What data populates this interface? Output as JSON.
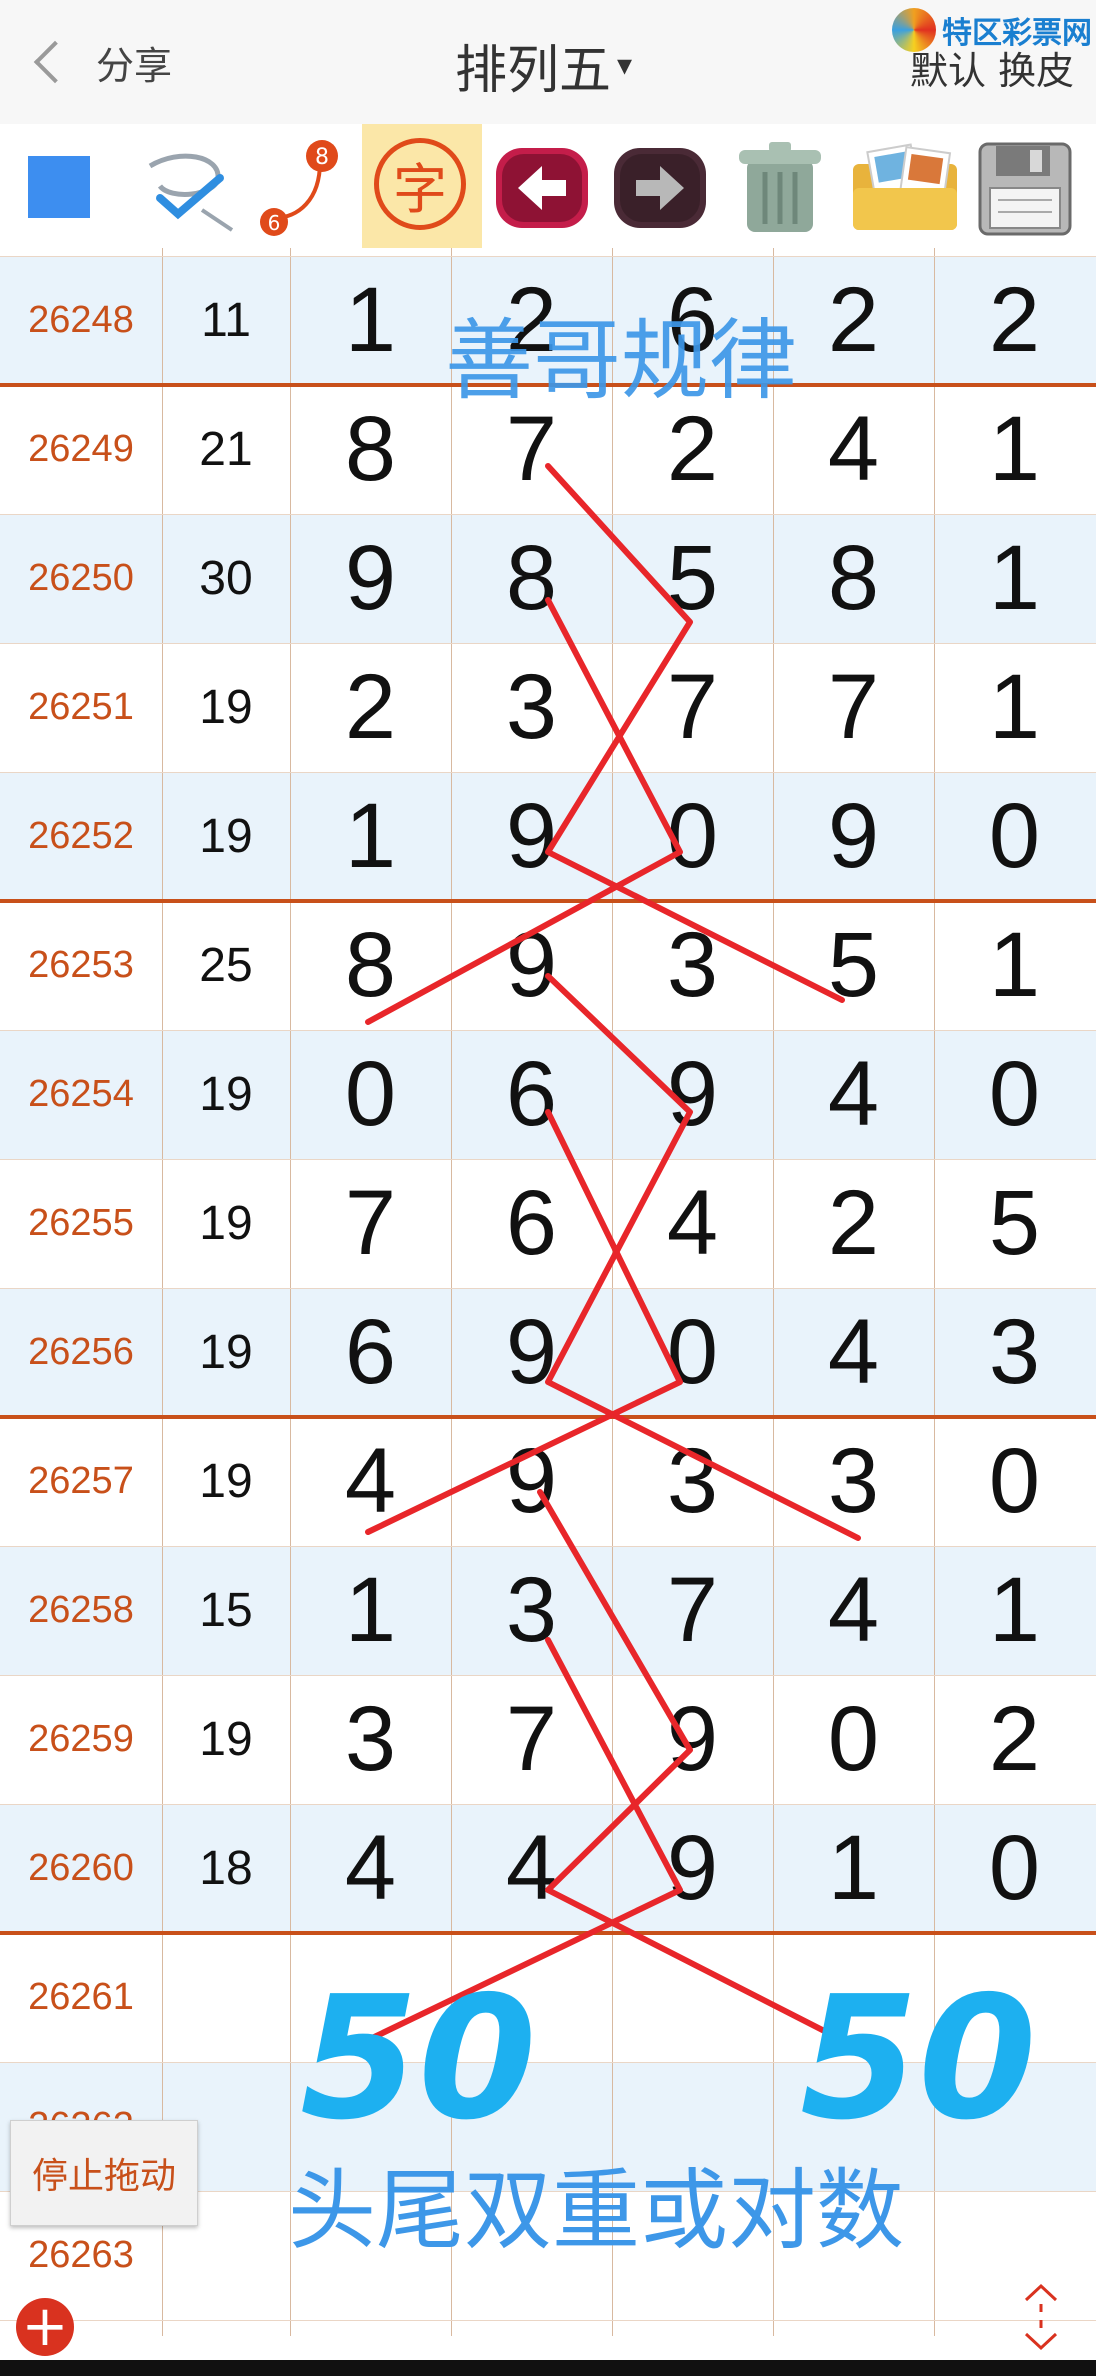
{
  "header": {
    "back_label": "分享",
    "title": "排列五",
    "title_caret": "▾",
    "logo_text": "特区彩票网",
    "skin_label": "默认 换皮"
  },
  "toolbar": {
    "zi_label": "字",
    "badge_top": "8",
    "badge_bottom": "6"
  },
  "rows": [
    {
      "no": "26248",
      "sum": "11",
      "d": [
        "1",
        "2",
        "6",
        "2",
        "2"
      ]
    },
    {
      "no": "26249",
      "sum": "21",
      "d": [
        "8",
        "7",
        "2",
        "4",
        "1"
      ]
    },
    {
      "no": "26250",
      "sum": "30",
      "d": [
        "9",
        "8",
        "5",
        "8",
        "1"
      ]
    },
    {
      "no": "26251",
      "sum": "19",
      "d": [
        "2",
        "3",
        "7",
        "7",
        "1"
      ]
    },
    {
      "no": "26252",
      "sum": "19",
      "d": [
        "1",
        "9",
        "0",
        "9",
        "0"
      ]
    },
    {
      "no": "26253",
      "sum": "25",
      "d": [
        "8",
        "9",
        "3",
        "5",
        "1"
      ]
    },
    {
      "no": "26254",
      "sum": "19",
      "d": [
        "0",
        "6",
        "9",
        "4",
        "0"
      ]
    },
    {
      "no": "26255",
      "sum": "19",
      "d": [
        "7",
        "6",
        "4",
        "2",
        "5"
      ]
    },
    {
      "no": "26256",
      "sum": "19",
      "d": [
        "6",
        "9",
        "0",
        "4",
        "3"
      ]
    },
    {
      "no": "26257",
      "sum": "19",
      "d": [
        "4",
        "9",
        "3",
        "3",
        "0"
      ]
    },
    {
      "no": "26258",
      "sum": "15",
      "d": [
        "1",
        "3",
        "7",
        "4",
        "1"
      ]
    },
    {
      "no": "26259",
      "sum": "19",
      "d": [
        "3",
        "7",
        "9",
        "0",
        "2"
      ]
    },
    {
      "no": "26260",
      "sum": "18",
      "d": [
        "4",
        "4",
        "9",
        "1",
        "0"
      ]
    },
    {
      "no": "26261",
      "sum": "",
      "d": [
        "",
        "",
        "",
        "",
        ""
      ]
    },
    {
      "no": "26262",
      "sum": "",
      "d": [
        "",
        "",
        "",
        "",
        ""
      ]
    },
    {
      "no": "26263",
      "sum": "",
      "d": [
        "",
        "",
        "",
        "",
        ""
      ]
    }
  ],
  "annotations": {
    "top_note": "善哥规律",
    "bottom_note": "头尾双重或对数",
    "big_left": "50",
    "big_right": "50",
    "stroke_color": "#e8262a",
    "text_color": "#3d97e8",
    "big_color": "#1db0f0"
  },
  "buttons": {
    "stop_drag": "停止拖动",
    "add": "+"
  },
  "colors": {
    "issue_text": "#c8501a",
    "row_alt": "#e9f3fb",
    "separator": "#c8501a",
    "accent_blue": "#3d8ef0"
  }
}
